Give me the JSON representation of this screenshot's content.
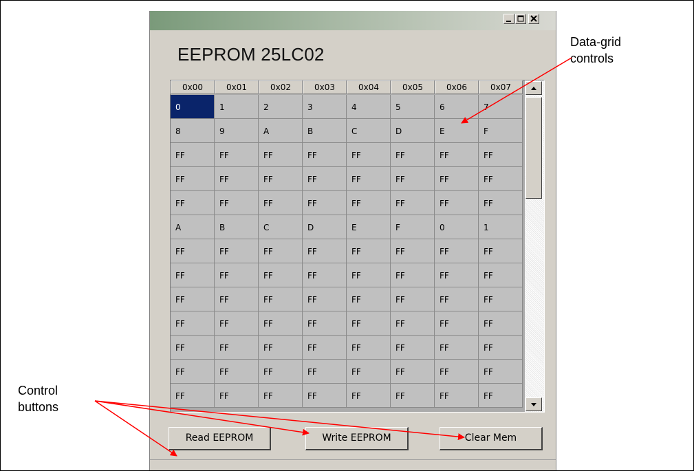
{
  "window": {
    "title": "EEPROM 25LC02",
    "controls": [
      "minimize-icon",
      "maximize-icon",
      "close-icon"
    ]
  },
  "grid": {
    "headers": [
      "0x00",
      "0x01",
      "0x02",
      "0x03",
      "0x04",
      "0x05",
      "0x06",
      "0x07"
    ],
    "rows": [
      [
        "0",
        "1",
        "2",
        "3",
        "4",
        "5",
        "6",
        "7"
      ],
      [
        "8",
        "9",
        "A",
        "B",
        "C",
        "D",
        "E",
        "F"
      ],
      [
        "FF",
        "FF",
        "FF",
        "FF",
        "FF",
        "FF",
        "FF",
        "FF"
      ],
      [
        "FF",
        "FF",
        "FF",
        "FF",
        "FF",
        "FF",
        "FF",
        "FF"
      ],
      [
        "FF",
        "FF",
        "FF",
        "FF",
        "FF",
        "FF",
        "FF",
        "FF"
      ],
      [
        "A",
        "B",
        "C",
        "D",
        "E",
        "F",
        "0",
        "1"
      ],
      [
        "FF",
        "FF",
        "FF",
        "FF",
        "FF",
        "FF",
        "FF",
        "FF"
      ],
      [
        "FF",
        "FF",
        "FF",
        "FF",
        "FF",
        "FF",
        "FF",
        "FF"
      ],
      [
        "FF",
        "FF",
        "FF",
        "FF",
        "FF",
        "FF",
        "FF",
        "FF"
      ],
      [
        "FF",
        "FF",
        "FF",
        "FF",
        "FF",
        "FF",
        "FF",
        "FF"
      ],
      [
        "FF",
        "FF",
        "FF",
        "FF",
        "FF",
        "FF",
        "FF",
        "FF"
      ],
      [
        "FF",
        "FF",
        "FF",
        "FF",
        "FF",
        "FF",
        "FF",
        "FF"
      ],
      [
        "FF",
        "FF",
        "FF",
        "FF",
        "FF",
        "FF",
        "FF",
        "FF"
      ]
    ],
    "selected_cell": "0"
  },
  "buttons": {
    "read": "Read EEPROM",
    "write": "Write EEPROM",
    "clear": "Clear Mem"
  },
  "annotations": {
    "data_grid_line1": "Data-grid",
    "data_grid_line2": "controls",
    "control_line1": "Control",
    "control_line2": "buttons",
    "arrow_color": "#ff0000"
  }
}
